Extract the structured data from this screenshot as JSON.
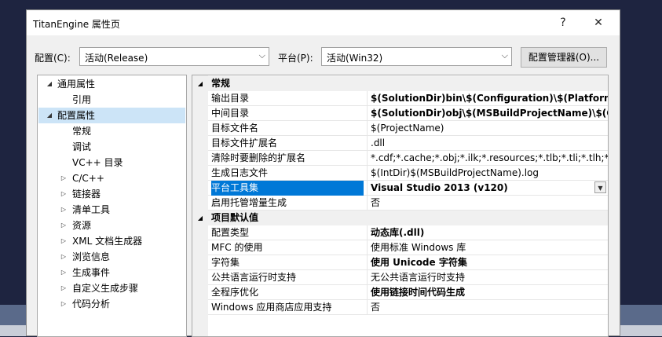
{
  "window": {
    "title": "TitanEngine 属性页",
    "help": "?",
    "close": "✕"
  },
  "toolbar": {
    "config_label": "配置(C):",
    "config_value": "活动(Release)",
    "platform_label": "平台(P):",
    "platform_value": "活动(Win32)",
    "config_manager_label": "配置管理器(O)..."
  },
  "tree": [
    {
      "label": "通用属性",
      "expander": "◢",
      "level": 0
    },
    {
      "label": "引用",
      "expander": "",
      "level": 1
    },
    {
      "label": "配置属性",
      "expander": "◢",
      "level": 0,
      "selected": true
    },
    {
      "label": "常规",
      "expander": "",
      "level": 1
    },
    {
      "label": "调试",
      "expander": "",
      "level": 1
    },
    {
      "label": "VC++ 目录",
      "expander": "",
      "level": 1
    },
    {
      "label": "C/C++",
      "expander": "▷",
      "level": 1
    },
    {
      "label": "链接器",
      "expander": "▷",
      "level": 1
    },
    {
      "label": "清单工具",
      "expander": "▷",
      "level": 1
    },
    {
      "label": "资源",
      "expander": "▷",
      "level": 1
    },
    {
      "label": "XML 文档生成器",
      "expander": "▷",
      "level": 1
    },
    {
      "label": "浏览信息",
      "expander": "▷",
      "level": 1
    },
    {
      "label": "生成事件",
      "expander": "▷",
      "level": 1
    },
    {
      "label": "自定义生成步骤",
      "expander": "▷",
      "level": 1
    },
    {
      "label": "代码分析",
      "expander": "▷",
      "level": 1
    }
  ],
  "grid": {
    "categories": [
      {
        "label": "常规",
        "expander": "◢",
        "rows": [
          {
            "name": "输出目录",
            "value": "$(SolutionDir)bin\\$(Configuration)\\$(Platform)\\",
            "bold": true
          },
          {
            "name": "中间目录",
            "value": "$(SolutionDir)obj\\$(MSBuildProjectName)\\$(Conf",
            "bold": true
          },
          {
            "name": "目标文件名",
            "value": "$(ProjectName)",
            "bold": false
          },
          {
            "name": "目标文件扩展名",
            "value": ".dll",
            "bold": false
          },
          {
            "name": "清除时要删除的扩展名",
            "value": "*.cdf;*.cache;*.obj;*.ilk;*.resources;*.tlb;*.tli;*.tlh;*.tmp;*",
            "bold": false
          },
          {
            "name": "生成日志文件",
            "value": "$(IntDir)$(MSBuildProjectName).log",
            "bold": false
          },
          {
            "name": "平台工具集",
            "value": "Visual Studio 2013 (v120)",
            "bold": true,
            "selected": true
          },
          {
            "name": "启用托管增量生成",
            "value": "否",
            "bold": false
          }
        ]
      },
      {
        "label": "项目默认值",
        "expander": "◢",
        "rows": [
          {
            "name": "配置类型",
            "value": "动态库(.dll)",
            "bold": true
          },
          {
            "name": "MFC 的使用",
            "value": "使用标准 Windows 库",
            "bold": false
          },
          {
            "name": "字符集",
            "value": "使用 Unicode 字符集",
            "bold": true
          },
          {
            "name": "公共语言运行时支持",
            "value": "无公共语言运行时支持",
            "bold": false
          },
          {
            "name": "全程序优化",
            "value": "使用链接时间代码生成",
            "bold": true
          },
          {
            "name": "Windows 应用商店应用支持",
            "value": "否",
            "bold": false
          }
        ]
      }
    ]
  },
  "colors": {
    "selection": "#0078d7",
    "tree_selection": "#cce4f7",
    "category_bg": "#f0f0f0"
  }
}
